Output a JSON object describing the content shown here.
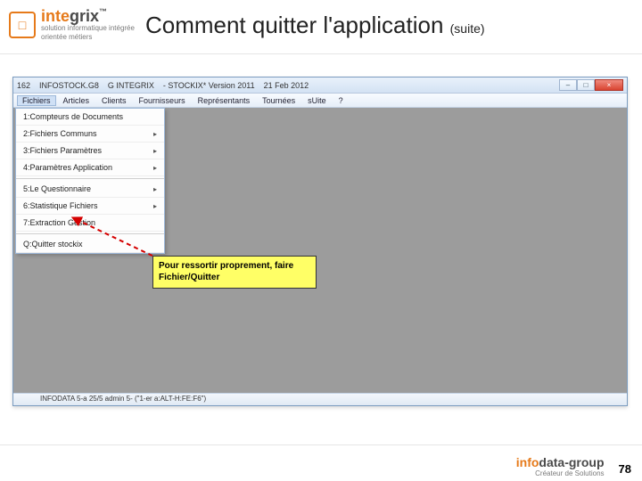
{
  "header": {
    "brand_prefix": "inte",
    "brand_suffix": "grix",
    "trademark": "™",
    "tagline1": "solution informatique intégrée",
    "tagline2": "orientée métiers",
    "title_main": "Comment quitter l'application ",
    "title_suite": "(suite)"
  },
  "window": {
    "titlebar": {
      "icon_text": "162",
      "app": "INFOSTOCK.G8",
      "org": "G INTEGRIX",
      "prod": "- STOCKIX* Version 2011",
      "date": "21 Feb 2012"
    },
    "winbtns": {
      "min": "–",
      "max": "□",
      "close": "×"
    },
    "menubar": [
      "Fichiers",
      "Articles",
      "Clients",
      "Fournisseurs",
      "Représentants",
      "Tournées",
      "sUite",
      "?"
    ],
    "dropdown": [
      {
        "label": "1:Compteurs de Documents",
        "sub": false
      },
      {
        "label": "2:Fichiers Communs",
        "sub": true
      },
      {
        "label": "3:Fichiers Paramètres",
        "sub": true
      },
      {
        "label": "4:Paramètres Application",
        "sub": true
      },
      {
        "label": "5:Le Questionnaire",
        "sub": true
      },
      {
        "label": "6:Statistique Fichiers",
        "sub": true
      },
      {
        "label": "7:Extraction Gestion",
        "sub": false
      },
      {
        "label": "Q:Quitter stockix",
        "sub": false
      }
    ],
    "callout_line1": "Pour ressortir proprement, faire",
    "callout_line2": "Fichier/Quitter",
    "statusbar": "INFODATA  5-a  25/5 admin  5- (\"1-er a:ALT-H:FE:F6\")"
  },
  "footer": {
    "brand_prefix": "info",
    "brand_suffix": "data-group",
    "tagline": "Créateur de Solutions",
    "page": "78"
  }
}
